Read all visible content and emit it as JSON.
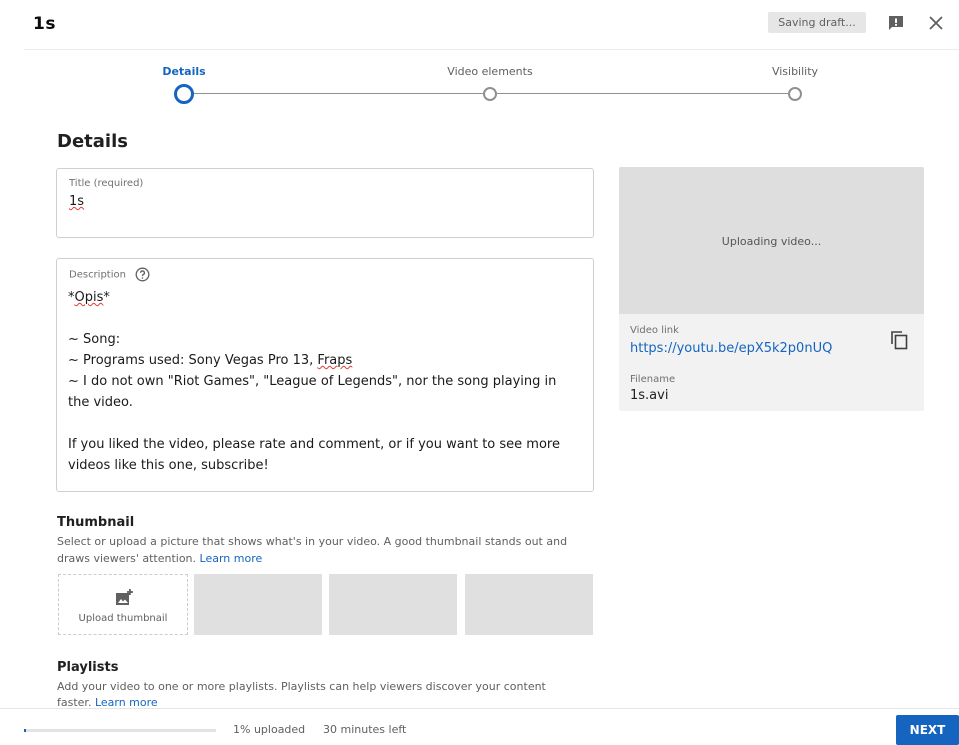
{
  "header": {
    "title": "1s",
    "saving_status": "Saving draft...",
    "feedback_icon": "feedback-icon",
    "close_icon": "close-icon"
  },
  "stepper": {
    "steps": [
      {
        "label": "Details",
        "state": "active"
      },
      {
        "label": "Video elements",
        "state": "inactive"
      },
      {
        "label": "Visibility",
        "state": "inactive"
      }
    ]
  },
  "details": {
    "heading": "Details",
    "title_field": {
      "label": "Title (required)",
      "value": "1s"
    },
    "description_field": {
      "label": "Description",
      "help_icon": "help-circle-icon",
      "lines": [
        "*Opis*",
        "",
        "~ Song:",
        "~ Programs used: Sony Vegas Pro 13, Fraps",
        "~ I do not own \"Riot Games\", \"League of Legends\", nor the song playing in",
        "the video.",
        "",
        "If you liked the video, please rate and comment, or if you want to see more",
        "videos like this one, subscribe!"
      ]
    }
  },
  "preview": {
    "status": "Uploading video...",
    "video_link_label": "Video link",
    "video_link": "https://youtu.be/epX5k2p0nUQ",
    "copy_icon": "copy-icon",
    "filename_label": "Filename",
    "filename": "1s.avi"
  },
  "thumbnail": {
    "heading": "Thumbnail",
    "help_line1": "Select or upload a picture that shows what's in your video. A good thumbnail stands out and",
    "help_line2": "draws viewers' attention.",
    "learn_more": "Learn more",
    "upload_label": "Upload thumbnail",
    "upload_icon": "add-photo-icon"
  },
  "playlists": {
    "heading": "Playlists",
    "help_line1": "Add your video to one or more playlists. Playlists can help viewers discover your content",
    "help_line2": "faster.",
    "learn_more": "Learn more"
  },
  "footer": {
    "progress_percent": 1,
    "uploaded_text": "1% uploaded",
    "time_left": "30 minutes left",
    "next_label": "NEXT"
  },
  "colors": {
    "accent": "#1565c0",
    "spellcheck": "#e53935"
  }
}
